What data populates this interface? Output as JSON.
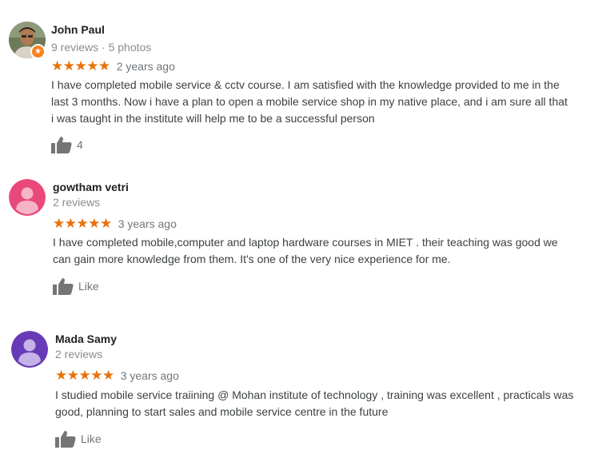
{
  "reviews": [
    {
      "name": "John Paul",
      "meta": "9 reviews · 5 photos",
      "stars": "★★★★★",
      "rating": 5,
      "time": "2 years ago",
      "text_lines": [
        "I have completed mobile service & cctv course. I am satisfied with the knowledge provided to me in the",
        "last 3 months. Now i have a plan to open a mobile service shop in my native place, and i am sure all that",
        "i was taught in the institute will help me to be a successful person"
      ],
      "likes": "4",
      "avatar": "photo-avatar"
    },
    {
      "name": "gowtham vetri",
      "meta": "2 reviews",
      "stars": "★★★★★",
      "rating": 5,
      "time": "3 years ago",
      "text_lines": [
        "I have completed  mobile,computer and laptop hardware courses in MIET . their  teaching was good we",
        "can gain more knowledge from them. It's one of the very nice experience for me."
      ],
      "likes": "Like",
      "avatar": "default-avatar",
      "avatar_color": "#e8497a"
    },
    {
      "name": "Mada Samy",
      "meta": "2 reviews",
      "stars": "★★★★★",
      "rating": 5,
      "time": "3 years ago",
      "text_lines": [
        "I studied mobile service traiining @ Mohan institute of technology , training was excellent , practicals was",
        "good, planning to start sales and mobile service centre in the future"
      ],
      "likes": "Like",
      "avatar": "default-avatar",
      "avatar_color": "#673ab7"
    }
  ],
  "colors": {
    "star": "#e8710a",
    "meta_text": "#8a8d91",
    "body_text": "#3c4043",
    "like_icon": "#757575"
  }
}
